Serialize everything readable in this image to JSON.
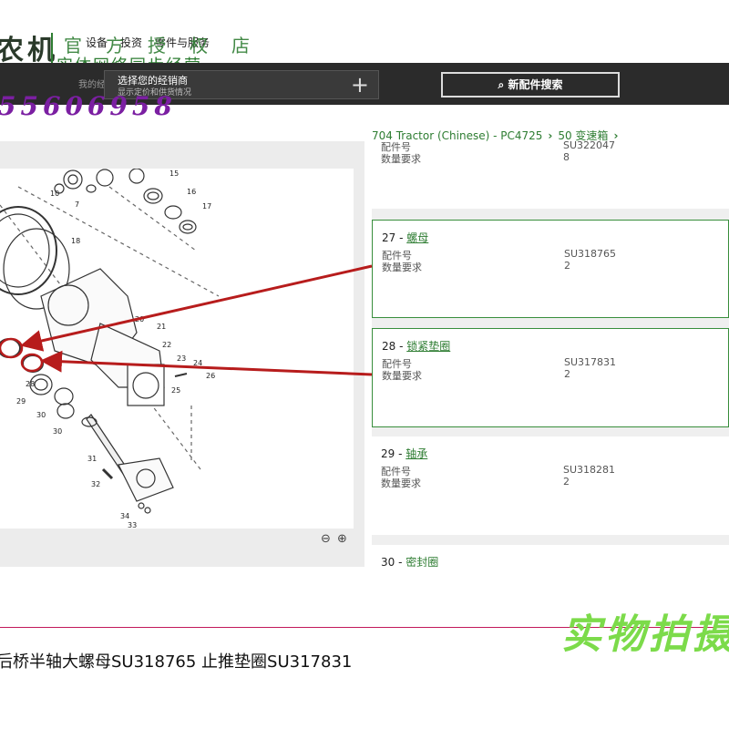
{
  "header": {
    "brand": "农机",
    "nav": [
      "设备",
      "投资",
      "零件与服务"
    ],
    "watermark_line1": "官方授权店",
    "watermark_line2": "实体网络同步经营",
    "phone": "55606958",
    "dealer_label": "我的经销商",
    "dealer_select": "选择您的经销商",
    "dealer_hint": "显示定价和供货情况",
    "dealer_add": "+",
    "new_search": "新配件搜索",
    "search_icon": "search-icon"
  },
  "breadcrumb": [
    "704 Tractor (Chinese) - PC4725",
    "50 变速箱"
  ],
  "parts": {
    "label_part_no": "配件号",
    "label_qty": "数量要求",
    "partial_top": {
      "part_no": "SU322047",
      "qty": "8"
    },
    "items": [
      {
        "index": "27",
        "name": "螺母",
        "part_no": "SU318765",
        "qty": "2",
        "selected": true
      },
      {
        "index": "28",
        "name": "锁紧垫圈",
        "part_no": "SU317831",
        "qty": "2",
        "selected": true
      },
      {
        "index": "29",
        "name": "轴承",
        "part_no": "SU318281",
        "qty": "2",
        "selected": false
      },
      {
        "index": "30",
        "name": "密封圈",
        "part_no": "",
        "qty": "",
        "selected": false
      }
    ]
  },
  "diagram": {
    "callouts": [
      "10",
      "7",
      "15",
      "16",
      "17",
      "18",
      "20",
      "21",
      "22",
      "23",
      "24",
      "25",
      "26",
      "28",
      "29",
      "30",
      "30",
      "31",
      "32",
      "34",
      "33"
    ],
    "zoom_out_icon": "zoom-out-icon",
    "zoom_in_icon": "zoom-in-icon"
  },
  "overlay": {
    "photo_tag": "实物拍摄",
    "caption": "后桥半轴大螺母SU318765 止推垫圈SU317831",
    "arrow_color": "#b71c1c"
  }
}
